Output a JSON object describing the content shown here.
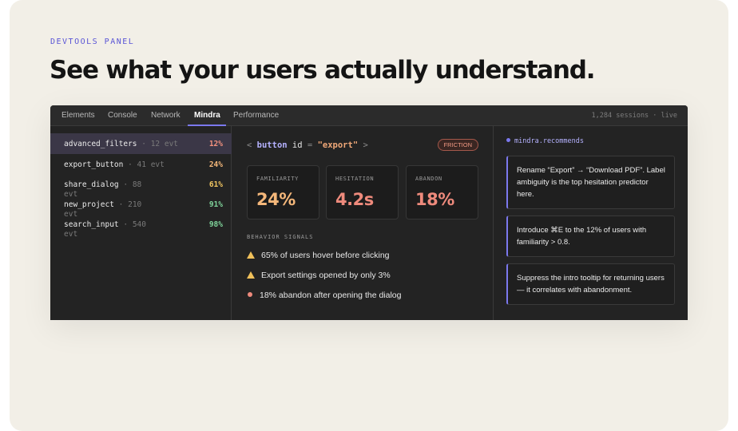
{
  "eyebrow": "DEVTOOLS PANEL",
  "headline": "See what your users actually understand.",
  "tabs": [
    "Elements",
    "Console",
    "Network",
    "Mindra",
    "Performance"
  ],
  "active_tab": "Mindra",
  "sessions": "1,284 sessions · live",
  "elements": [
    {
      "name": "advanced_filters",
      "events": "· 12 evt",
      "pct": "12%",
      "color": "#f2917e",
      "selected": true
    },
    {
      "name": "export_button",
      "events": "· 41 evt",
      "pct": "24%",
      "color": "#f4b77a"
    },
    {
      "name": "share_dialog",
      "events": "· 88",
      "wrap": "evt",
      "pct": "61%",
      "color": "#f0c560"
    },
    {
      "name": "new_project",
      "events": "· 210",
      "wrap": "evt",
      "pct": "91%",
      "color": "#7fd49a"
    },
    {
      "name": "search_input",
      "events": "· 540",
      "wrap": "evt",
      "pct": "98%",
      "color": "#7fd49a"
    }
  ],
  "detail": {
    "code": {
      "open": "<",
      "tag": "button",
      "attr": "id",
      "eq": "=",
      "value": "\"export\"",
      "close": ">"
    },
    "badge": "FRICTION",
    "metrics": [
      {
        "label": "FAMILIARITY",
        "value": "24%",
        "color": "#f4b77a"
      },
      {
        "label": "HESITATION",
        "value": "4.2s",
        "color": "#ee8a7c"
      },
      {
        "label": "ABANDON",
        "value": "18%",
        "color": "#ee8a7c"
      }
    ],
    "signals_title": "BEHAVIOR SIGNALS",
    "signals": [
      {
        "icon": "warning-icon",
        "text": "65% of users hover before clicking"
      },
      {
        "icon": "warning-icon",
        "text": "Export settings opened by only 3%"
      },
      {
        "icon": "dot-icon",
        "text": "18% abandon after opening the dialog"
      }
    ]
  },
  "recommendations": {
    "title": "mindra.recommends",
    "items": [
      "Rename “Export” → “Download PDF”. Label ambiguity is the top hesitation predictor here.",
      "Introduce ⌘E to the 12% of users with familiarity > 0.8.",
      "Suppress the intro tooltip for returning users — it correlates with abandonment."
    ]
  },
  "colors": {
    "accent": "#7b78ee",
    "background": "#f2efe7",
    "panel": "#232323"
  }
}
